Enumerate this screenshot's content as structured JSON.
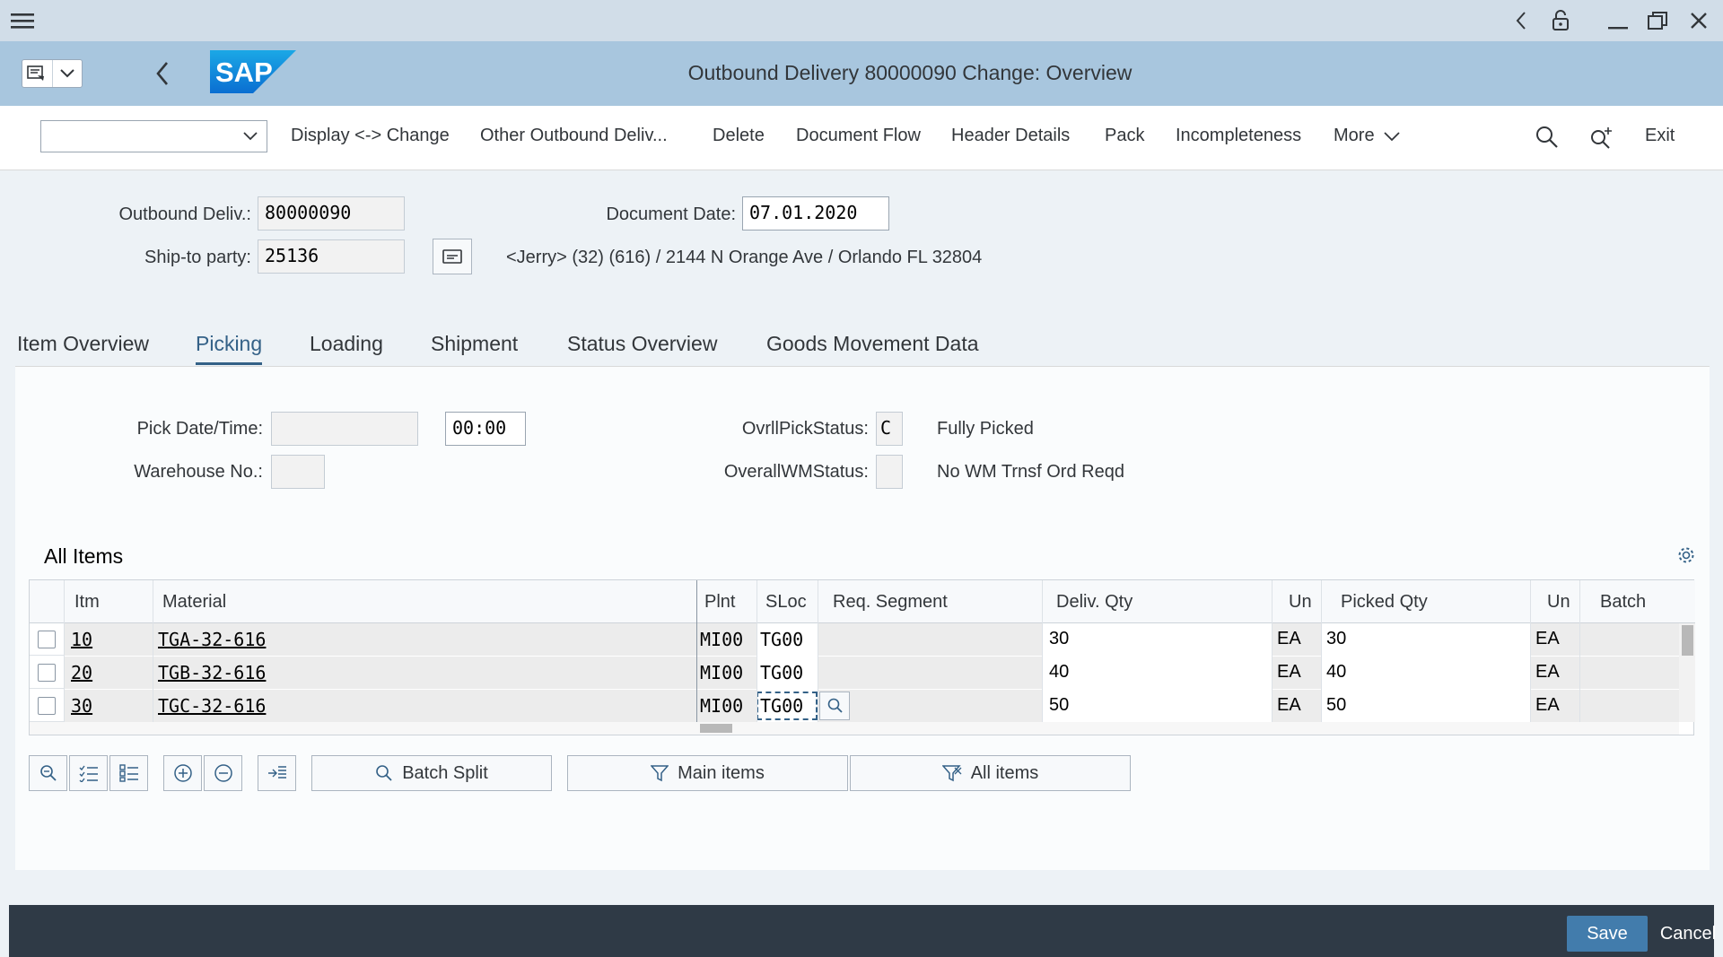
{
  "window": {
    "title": "Outbound Delivery 80000090 Change: Overview",
    "logo_text": "SAP"
  },
  "toolbar": {
    "select_value": "",
    "display_change": "Display <-> Change",
    "other_delivery": "Other Outbound Deliv...",
    "delete": "Delete",
    "document_flow": "Document Flow",
    "header_details": "Header Details",
    "pack": "Pack",
    "incompleteness": "Incompleteness",
    "more": "More",
    "exit": "Exit"
  },
  "header": {
    "outbound_label": "Outbound Deliv.:",
    "outbound_value": "80000090",
    "doc_date_label": "Document Date:",
    "doc_date_value": "07.01.2020",
    "ship_to_label": "Ship-to party:",
    "ship_to_value": "25136",
    "ship_to_address": "<Jerry> (32) (616) / 2144 N Orange Ave / Orlando FL 32804"
  },
  "tabs": [
    "Item Overview",
    "Picking",
    "Loading",
    "Shipment",
    "Status Overview",
    "Goods Movement Data"
  ],
  "active_tab": "Picking",
  "picking": {
    "pick_date_label": "Pick Date/Time:",
    "pick_date_value": "",
    "pick_time_value": "00:00",
    "warehouse_label": "Warehouse No.:",
    "warehouse_value": "",
    "ovrl_pick_label": "OvrllPickStatus:",
    "ovrl_pick_value": "C",
    "ovrl_pick_text": "Fully Picked",
    "overall_wm_label": "OverallWMStatus:",
    "overall_wm_value": "",
    "overall_wm_text": "No WM Trnsf Ord Reqd"
  },
  "table": {
    "title": "All Items",
    "columns": [
      "Itm",
      "Material",
      "Plnt",
      "SLoc",
      "Req. Segment",
      "Deliv. Qty",
      "Un",
      "Picked Qty",
      "Un",
      "Batch"
    ],
    "rows": [
      {
        "itm": "10",
        "material": "TGA-32-616",
        "plnt": "MI00",
        "sloc": "TG00",
        "req_segment": "",
        "deliv_qty": "30",
        "un": "EA",
        "picked_qty": "30",
        "un2": "EA",
        "batch": ""
      },
      {
        "itm": "20",
        "material": "TGB-32-616",
        "plnt": "MI00",
        "sloc": "TG00",
        "req_segment": "",
        "deliv_qty": "40",
        "un": "EA",
        "picked_qty": "40",
        "un2": "EA",
        "batch": ""
      },
      {
        "itm": "30",
        "material": "TGC-32-616",
        "plnt": "MI00",
        "sloc": "TG00",
        "req_segment": "",
        "deliv_qty": "50",
        "un": "EA",
        "picked_qty": "50",
        "un2": "EA",
        "batch": ""
      }
    ]
  },
  "buttons": {
    "batch_split": "Batch Split",
    "main_items": "Main items",
    "all_items": "All items"
  },
  "footer": {
    "save": "Save",
    "cancel": "Cancel"
  },
  "colors": {
    "title_bar": "#a8c6de",
    "system_bar": "#d1dde8",
    "footer": "#2f3a46",
    "save_button": "#427cac",
    "active_tab": "#346187"
  }
}
